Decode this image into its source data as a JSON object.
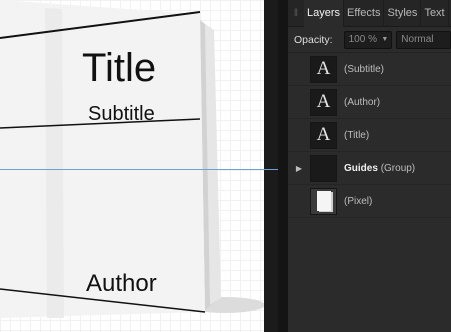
{
  "cover": {
    "title": "Title",
    "subtitle": "Subtitle",
    "author": "Author"
  },
  "panel": {
    "tabs": [
      "Layers",
      "Effects",
      "Styles",
      "Text"
    ],
    "active_tab": "Layers",
    "opacity": {
      "label": "Opacity:",
      "value": "100 %"
    },
    "blend_mode": "Normal",
    "layers": [
      {
        "name": "(Subtitle)",
        "kind": "",
        "thumb": "A",
        "icon": "text-layer-icon"
      },
      {
        "name": "(Author)",
        "kind": "",
        "thumb": "A",
        "icon": "text-layer-icon"
      },
      {
        "name": "(Title)",
        "kind": "",
        "thumb": "A",
        "icon": "text-layer-icon"
      },
      {
        "name": "Guides",
        "kind": "(Group)",
        "thumb": "",
        "icon": "group-icon"
      },
      {
        "name": "(Pixel)",
        "kind": "",
        "thumb": "",
        "icon": "pixel-layer-icon"
      }
    ]
  },
  "colors": {
    "guide": "#6f9fd8",
    "panel_bg": "#2b2b2b",
    "canvas_bg": "#ffffff"
  }
}
